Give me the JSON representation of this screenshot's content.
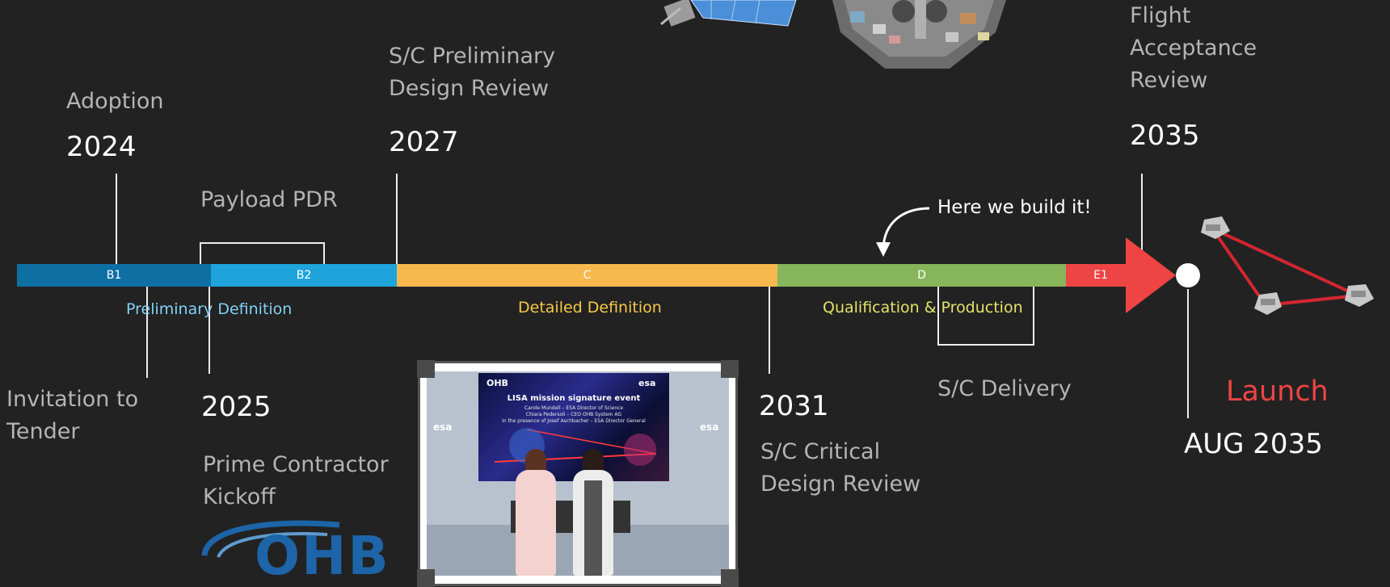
{
  "milestones": {
    "adoption": {
      "label": "Adoption",
      "year": "2024"
    },
    "sc_pdr": {
      "label_line1": "S/C Preliminary",
      "label_line2": "Design Review",
      "year": "2027"
    },
    "flight_acceptance": {
      "label_line1": "Flight",
      "label_line2": "Acceptance",
      "label_line3": "Review",
      "year": "2035"
    },
    "payload_pdr": {
      "label": "Payload PDR"
    },
    "invitation": {
      "label_line1": "Invitation to",
      "label_line2": "Tender"
    },
    "kickoff": {
      "year": "2025",
      "label_line1": "Prime Contractor",
      "label_line2": "Kickoff"
    },
    "sc_cdr": {
      "year": "2031",
      "label_line1": "S/C Critical",
      "label_line2": "Design Review"
    },
    "sc_delivery": {
      "label": "S/C Delivery"
    },
    "launch": {
      "label": "Launch",
      "date": "AUG 2035"
    }
  },
  "phases": {
    "b1": "B1",
    "b2": "B2",
    "c": "C",
    "d": "D",
    "e1": "E1"
  },
  "phase_captions": {
    "preliminary": "Preliminary Definition",
    "detailed": "Detailed Definition",
    "qualification": "Qualification & Production"
  },
  "annotation": "Here we build it!",
  "photo": {
    "screen_logo": "OHB",
    "screen_brand": "esa",
    "screen_title": "LISA mission signature event",
    "screen_line1": "Carole Mundell – ESA Director of Science",
    "screen_line2": "Chiara Pedersoli – CEO OHB System AG",
    "screen_line3": "in the presence of Josef Aschbacher – ESA Director General",
    "wall_brand_left": "esa",
    "wall_brand_right": "esa"
  },
  "logo": {
    "text": "OHB"
  },
  "colors": {
    "background": "#222222",
    "b1": "#0e6fa3",
    "b2": "#1fa3db",
    "c": "#f7b84e",
    "d": "#86b55a",
    "e1": "#ef4444",
    "launch_red": "#ef4444",
    "ohb_blue": "#1d64a8",
    "caption_blue": "#7fd2f5",
    "caption_yellow": "#f7c948",
    "caption_green": "#e2e36a"
  },
  "icons": [
    "satellite-icon",
    "spacecraft-top-icon",
    "spacecraft-constellation-icon",
    "curved-arrow-icon"
  ]
}
